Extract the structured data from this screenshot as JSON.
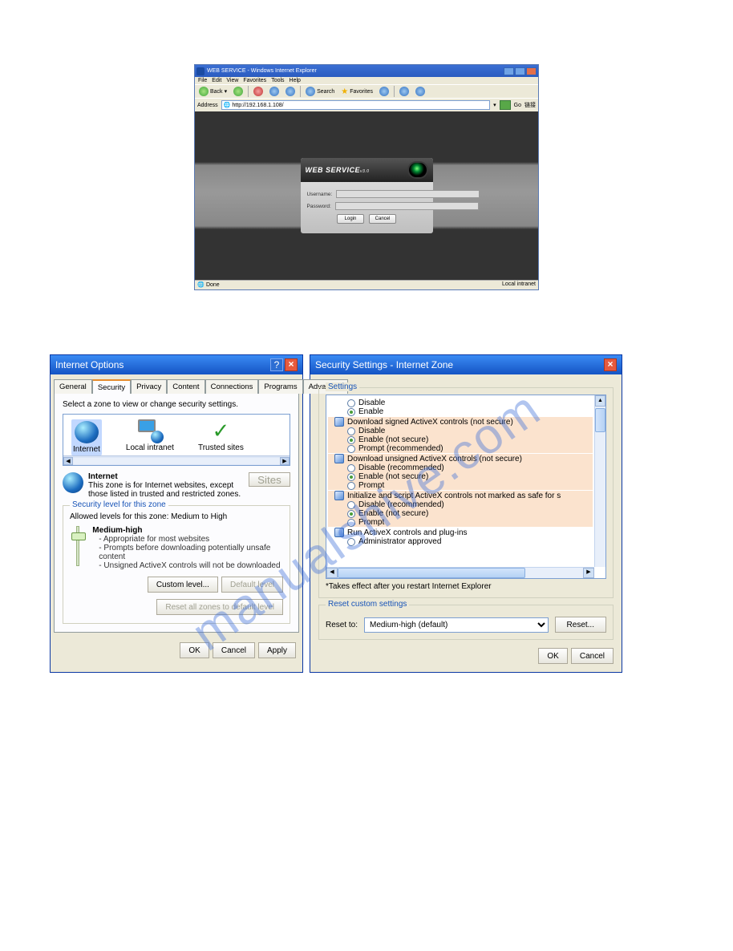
{
  "watermark": "manualshive.com",
  "ie": {
    "title": "WEB SERVICE - Windows Internet Explorer",
    "menu": [
      "File",
      "Edit",
      "View",
      "Favorites",
      "Tools",
      "Help"
    ],
    "tool": {
      "back": "Back",
      "search": "Search",
      "favorites": "Favorites"
    },
    "addr": {
      "label": "Address",
      "url": "http://192.168.1.108/",
      "go": "Go",
      "links": "链接"
    },
    "login": {
      "brand": "WEB  SERVICE",
      "ver": "v3.0",
      "user": "Username:",
      "pass": "Password:",
      "login": "Login",
      "cancel": "Cancel"
    },
    "status": {
      "done": "Done",
      "zone": "Local intranet"
    }
  },
  "opts": {
    "title": "Internet Options",
    "tabs": [
      "General",
      "Security",
      "Privacy",
      "Content",
      "Connections",
      "Programs",
      "Advanced"
    ],
    "select_text": "Select a zone to view or change security settings.",
    "zones": {
      "internet": "Internet",
      "local": "Local intranet",
      "trusted": "Trusted sites"
    },
    "zi": {
      "h": "Internet",
      "d": "This zone is for Internet websites, except those listed in trusted and restricted zones."
    },
    "sites": "Sites",
    "sec": {
      "lg": "Security level for this zone",
      "allowed": "Allowed levels for this zone: Medium to High",
      "h": "Medium-high",
      "b1": "- Appropriate for most websites",
      "b2": "- Prompts before downloading potentially unsafe content",
      "b3": "- Unsigned ActiveX controls will not be downloaded"
    },
    "custom": "Custom level...",
    "defl": "Default level",
    "resetall": "Reset all zones to default level",
    "ok": "OK",
    "cancel": "Cancel",
    "apply": "Apply"
  },
  "ss": {
    "title": "Security Settings - Internet Zone",
    "lg": "Settings",
    "opts": {
      "disable": "Disable",
      "enable": "Enable",
      "enable_ns": "Enable (not secure)",
      "prompt": "Prompt",
      "prompt_rec": "Prompt (recommended)",
      "disable_rec": "Disable (recommended)",
      "admin": "Administrator approved"
    },
    "cats": {
      "c1": "Download signed ActiveX controls (not secure)",
      "c2": "Download unsigned ActiveX controls (not secure)",
      "c3": "Initialize and script ActiveX controls not marked as safe for s",
      "c4": "Run ActiveX controls and plug-ins"
    },
    "note": "*Takes effect after you restart Internet Explorer",
    "reset": {
      "lg": "Reset custom settings",
      "label": "Reset to:",
      "value": "Medium-high (default)",
      "btn": "Reset..."
    },
    "ok": "OK",
    "cancel": "Cancel"
  }
}
